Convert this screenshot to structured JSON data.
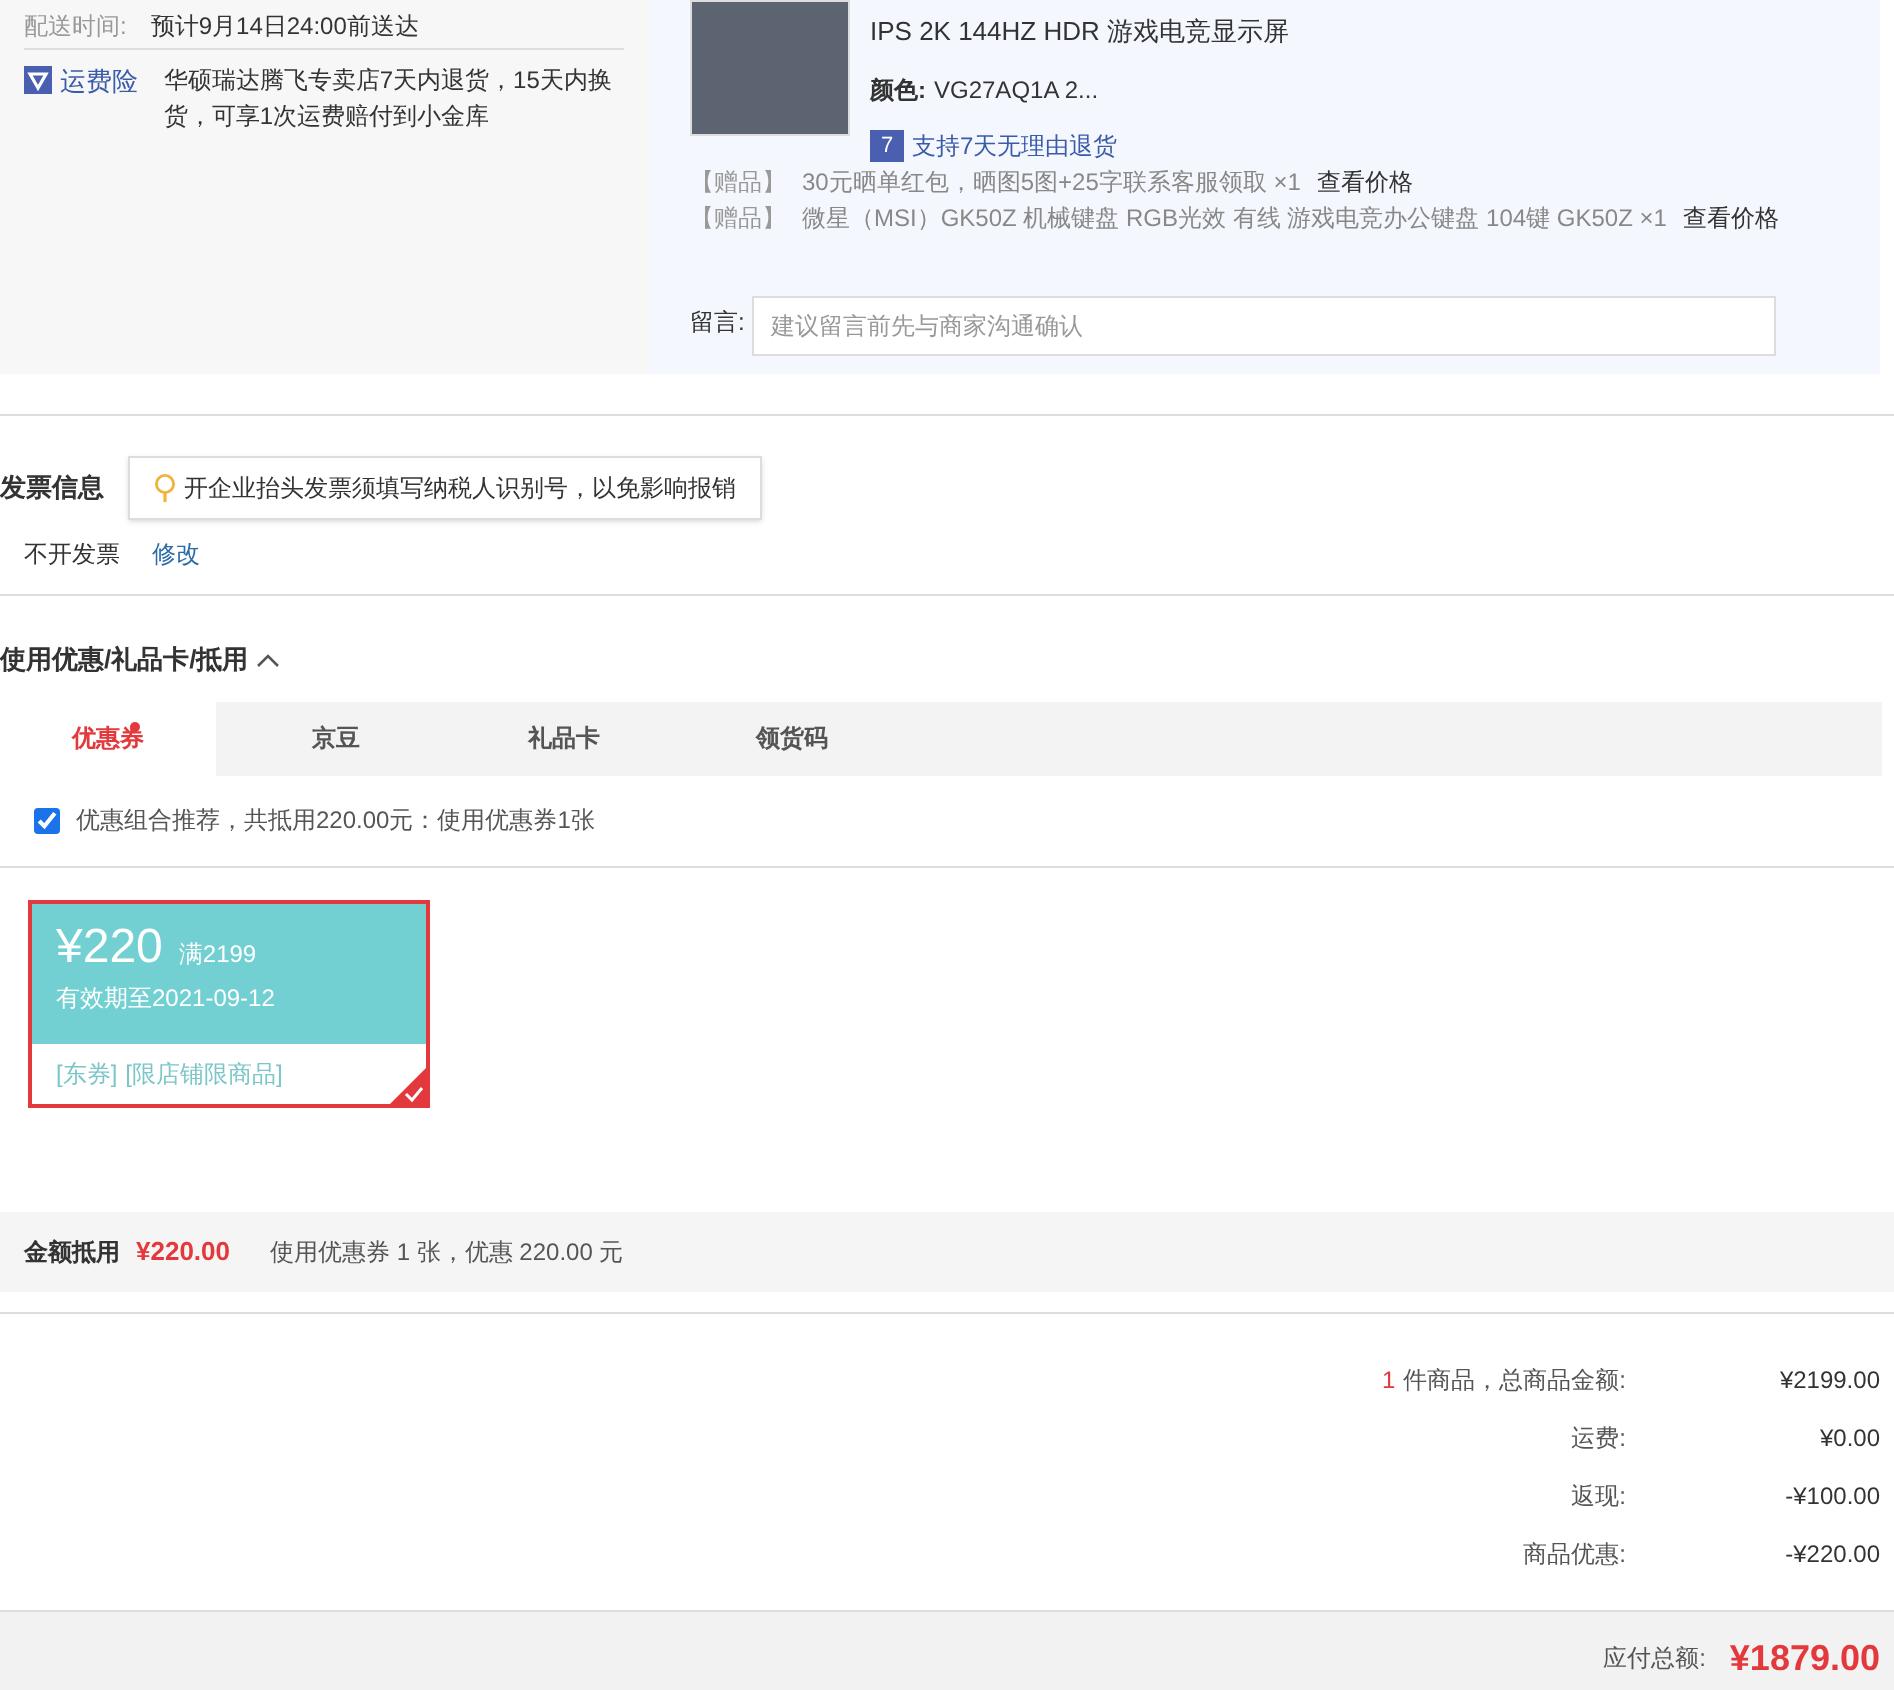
{
  "delivery": {
    "label": "配送时间:",
    "value": "预计9月14日24:00前送达"
  },
  "insurance": {
    "label": "运费险",
    "text": "华硕瑞达腾飞专卖店7天内退货，15天内换货，可享1次运费赔付到小金库"
  },
  "product": {
    "title": "IPS 2K 144HZ HDR 游戏电竞显示屏",
    "color_label": "颜色:",
    "color_value": "VG27AQ1A 2...",
    "return_badge": "7",
    "return_text": "支持7天无理由退货",
    "gifts": [
      {
        "tag": "【赠品】",
        "text": "30元晒单红包，晒图5图+25字联系客服领取 ×1",
        "link": "查看价格"
      },
      {
        "tag": "【赠品】",
        "text": "微星（MSI）GK50Z 机械键盘 RGB光效 有线 游戏电竞办公键盘 104键 GK50Z ×1",
        "link": "查看价格"
      }
    ],
    "message": {
      "label": "留言:",
      "placeholder": "建议留言前先与商家沟通确认"
    }
  },
  "invoice": {
    "title": "发票信息",
    "tip": "开企业抬头发票须填写纳税人识别号，以免影响报销",
    "value": "不开发票",
    "edit": "修改"
  },
  "discount": {
    "title": "使用优惠/礼品卡/抵用",
    "expanded": true,
    "tabs": [
      {
        "label": "优惠券",
        "selected": true,
        "dot": true
      },
      {
        "label": "京豆",
        "selected": false,
        "dot": false
      },
      {
        "label": "礼品卡",
        "selected": false,
        "dot": false
      },
      {
        "label": "领货码",
        "selected": false,
        "dot": false
      }
    ],
    "recommend": {
      "checked": true,
      "text": "优惠组合推荐，共抵用220.00元：使用优惠券1张"
    },
    "coupons": [
      {
        "amount": "¥220",
        "condition": "满2199",
        "expiry": "有效期至2021-09-12",
        "tags": [
          "[东券]",
          "[限店铺限商品]"
        ],
        "selected": true
      }
    ],
    "summary": {
      "label": "金额抵用",
      "amount": "¥220.00",
      "text": "使用优惠券 1 张，优惠 220.00 元"
    }
  },
  "totals": [
    {
      "count": "1",
      "label": "件商品，总商品金额:",
      "value": "¥2199.00"
    },
    {
      "label": "运费:",
      "value": "¥0.00"
    },
    {
      "label": "返现:",
      "value": "-¥100.00"
    },
    {
      "label": "商品优惠:",
      "value": "-¥220.00"
    }
  ],
  "payable": {
    "label": "应付总额:",
    "value": "¥1879.00"
  }
}
